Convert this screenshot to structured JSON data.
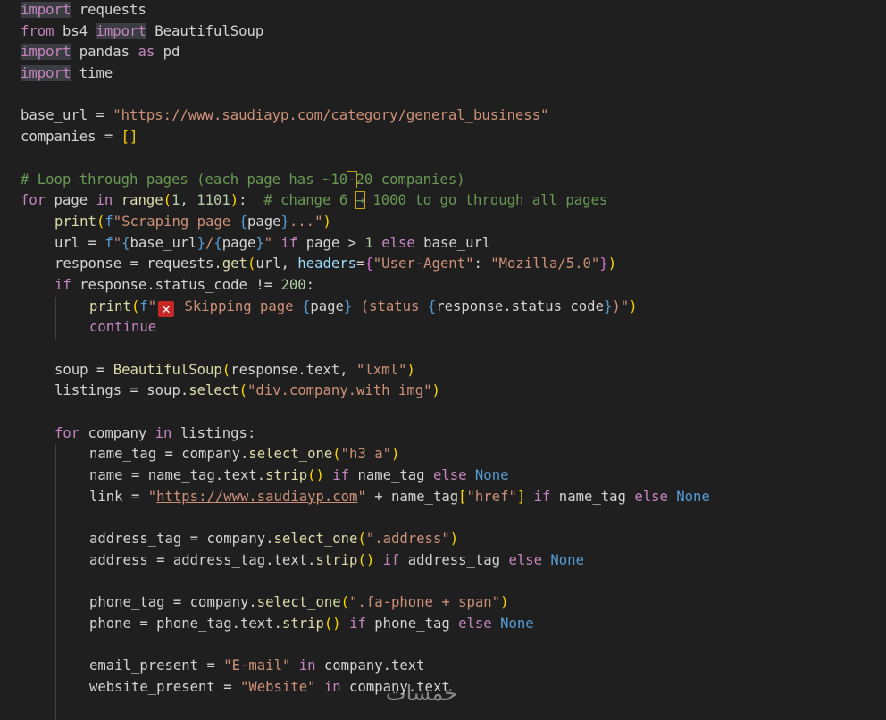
{
  "lines": [
    {
      "id": "l1",
      "indent": 0,
      "tokens": [
        [
          "import",
          "kw-purple hl-import"
        ],
        [
          " requests",
          "plain"
        ]
      ]
    },
    {
      "id": "l2",
      "indent": 0,
      "tokens": [
        [
          "from",
          "kw-purple"
        ],
        [
          " bs4 ",
          "plain"
        ],
        [
          "import",
          "kw-purple hl-import"
        ],
        [
          " BeautifulSoup",
          "plain"
        ]
      ]
    },
    {
      "id": "l3",
      "indent": 0,
      "tokens": [
        [
          "import",
          "kw-purple hl-import"
        ],
        [
          " pandas ",
          "plain"
        ],
        [
          "as",
          "kw-purple"
        ],
        [
          " pd",
          "plain"
        ]
      ]
    },
    {
      "id": "l4",
      "indent": 0,
      "tokens": [
        [
          "import",
          "kw-purple hl-import"
        ],
        [
          " time",
          "plain"
        ]
      ]
    },
    {
      "id": "l5",
      "indent": 0,
      "tokens": []
    },
    {
      "id": "l6",
      "indent": 0,
      "tokens": [
        [
          "base_url",
          "plain"
        ],
        [
          " = ",
          "plain"
        ],
        [
          "\"",
          "str"
        ],
        [
          "https://www.saudiayp.com/category/general_business",
          "str-link"
        ],
        [
          "\"",
          "str"
        ]
      ]
    },
    {
      "id": "l7",
      "indent": 0,
      "tokens": [
        [
          "companies",
          "plain"
        ],
        [
          " = ",
          "plain"
        ],
        [
          "[]",
          "paren1"
        ]
      ]
    },
    {
      "id": "l8",
      "indent": 0,
      "tokens": []
    },
    {
      "id": "l9",
      "indent": 0,
      "tokens": [
        [
          "# Loop through pages (each page has ~10",
          "comment"
        ],
        [
          "-",
          "comment warnbox"
        ],
        [
          "20 companies)",
          "comment"
        ]
      ]
    },
    {
      "id": "l10",
      "indent": 0,
      "tokens": [
        [
          "for",
          "kw-purple"
        ],
        [
          " page ",
          "plain"
        ],
        [
          "in",
          "kw-purple"
        ],
        [
          " ",
          "plain"
        ],
        [
          "range",
          "fn"
        ],
        [
          "(",
          "paren1"
        ],
        [
          "1",
          "num"
        ],
        [
          ", ",
          "plain"
        ],
        [
          "1101",
          "num"
        ],
        [
          ")",
          "paren1"
        ],
        [
          ":  ",
          "plain"
        ],
        [
          "# change 6 ",
          "comment"
        ],
        [
          "→",
          "comment warnbox"
        ],
        [
          " 1000 to go through all pages",
          "comment"
        ]
      ]
    },
    {
      "id": "l11",
      "indent": 1,
      "tokens": [
        [
          "print",
          "fn"
        ],
        [
          "(",
          "paren1"
        ],
        [
          "f",
          "kw-blue"
        ],
        [
          "\"Scraping page ",
          "str"
        ],
        [
          "{",
          "kw-blue"
        ],
        [
          "page",
          "plain"
        ],
        [
          "}",
          "kw-blue"
        ],
        [
          "...\"",
          "str"
        ],
        [
          ")",
          "paren1"
        ]
      ]
    },
    {
      "id": "l12",
      "indent": 1,
      "tokens": [
        [
          "url",
          "plain"
        ],
        [
          " = ",
          "plain"
        ],
        [
          "f",
          "kw-blue"
        ],
        [
          "\"",
          "str"
        ],
        [
          "{",
          "kw-blue"
        ],
        [
          "base_url",
          "plain"
        ],
        [
          "}",
          "kw-blue"
        ],
        [
          "/",
          "str"
        ],
        [
          "{",
          "kw-blue"
        ],
        [
          "page",
          "plain"
        ],
        [
          "}",
          "kw-blue"
        ],
        [
          "\"",
          "str"
        ],
        [
          " ",
          "plain"
        ],
        [
          "if",
          "kw-purple"
        ],
        [
          " page > ",
          "plain"
        ],
        [
          "1",
          "num"
        ],
        [
          " ",
          "plain"
        ],
        [
          "else",
          "kw-purple"
        ],
        [
          " base_url",
          "plain"
        ]
      ]
    },
    {
      "id": "l13",
      "indent": 1,
      "tokens": [
        [
          "response",
          "plain"
        ],
        [
          " = requests.",
          "plain"
        ],
        [
          "get",
          "fn"
        ],
        [
          "(",
          "paren1"
        ],
        [
          "url, ",
          "plain"
        ],
        [
          "headers",
          "var"
        ],
        [
          "=",
          "plain"
        ],
        [
          "{",
          "paren2"
        ],
        [
          "\"User-Agent\"",
          "str"
        ],
        [
          ": ",
          "plain"
        ],
        [
          "\"Mozilla/5.0\"",
          "str"
        ],
        [
          "}",
          "paren2"
        ],
        [
          ")",
          "paren1"
        ]
      ]
    },
    {
      "id": "l14",
      "indent": 1,
      "tokens": [
        [
          "if",
          "kw-purple"
        ],
        [
          " response.status_code != ",
          "plain"
        ],
        [
          "200",
          "num"
        ],
        [
          ":",
          "plain"
        ]
      ]
    },
    {
      "id": "l15",
      "indent": 2,
      "tokens": [
        [
          "print",
          "fn"
        ],
        [
          "(",
          "paren1"
        ],
        [
          "f",
          "kw-blue"
        ],
        [
          "\"",
          "str"
        ],
        [
          "✕",
          "x-emoji"
        ],
        [
          " Skipping page ",
          "str"
        ],
        [
          "{",
          "kw-blue"
        ],
        [
          "page",
          "plain"
        ],
        [
          "}",
          "kw-blue"
        ],
        [
          " (status ",
          "str"
        ],
        [
          "{",
          "kw-blue"
        ],
        [
          "response.status_code",
          "plain"
        ],
        [
          "}",
          "kw-blue"
        ],
        [
          ")\"",
          "str"
        ],
        [
          ")",
          "paren1"
        ]
      ]
    },
    {
      "id": "l16",
      "indent": 2,
      "tokens": [
        [
          "continue",
          "kw-purple"
        ]
      ]
    },
    {
      "id": "l17",
      "indent": 1,
      "tokens": []
    },
    {
      "id": "l18",
      "indent": 1,
      "tokens": [
        [
          "soup",
          "plain"
        ],
        [
          " = ",
          "plain"
        ],
        [
          "BeautifulSoup",
          "fn"
        ],
        [
          "(",
          "paren1"
        ],
        [
          "response.text, ",
          "plain"
        ],
        [
          "\"lxml\"",
          "str"
        ],
        [
          ")",
          "paren1"
        ]
      ]
    },
    {
      "id": "l19",
      "indent": 1,
      "tokens": [
        [
          "listings",
          "plain"
        ],
        [
          " = soup.",
          "plain"
        ],
        [
          "select",
          "fn"
        ],
        [
          "(",
          "paren1"
        ],
        [
          "\"div.company.with_img\"",
          "str"
        ],
        [
          ")",
          "paren1"
        ]
      ]
    },
    {
      "id": "l20",
      "indent": 1,
      "tokens": []
    },
    {
      "id": "l21",
      "indent": 1,
      "tokens": [
        [
          "for",
          "kw-purple"
        ],
        [
          " company ",
          "plain"
        ],
        [
          "in",
          "kw-purple"
        ],
        [
          " listings:",
          "plain"
        ]
      ]
    },
    {
      "id": "l22",
      "indent": 2,
      "tokens": [
        [
          "name_tag",
          "plain"
        ],
        [
          " = company.",
          "plain"
        ],
        [
          "select_one",
          "fn"
        ],
        [
          "(",
          "paren1"
        ],
        [
          "\"h3 a\"",
          "str"
        ],
        [
          ")",
          "paren1"
        ]
      ]
    },
    {
      "id": "l23",
      "indent": 2,
      "tokens": [
        [
          "name",
          "plain"
        ],
        [
          " = name_tag.text.",
          "plain"
        ],
        [
          "strip",
          "fn"
        ],
        [
          "()",
          "paren1"
        ],
        [
          " ",
          "plain"
        ],
        [
          "if",
          "kw-purple"
        ],
        [
          " name_tag ",
          "plain"
        ],
        [
          "else",
          "kw-purple"
        ],
        [
          " ",
          "plain"
        ],
        [
          "None",
          "kw-blue"
        ]
      ]
    },
    {
      "id": "l24",
      "indent": 2,
      "tokens": [
        [
          "link",
          "plain"
        ],
        [
          " = ",
          "plain"
        ],
        [
          "\"",
          "str"
        ],
        [
          "https://www.saudiayp.com",
          "str-link"
        ],
        [
          "\"",
          "str"
        ],
        [
          " + name_tag",
          "plain"
        ],
        [
          "[",
          "paren1"
        ],
        [
          "\"href\"",
          "str"
        ],
        [
          "]",
          "paren1"
        ],
        [
          " ",
          "plain"
        ],
        [
          "if",
          "kw-purple"
        ],
        [
          " name_tag ",
          "plain"
        ],
        [
          "else",
          "kw-purple"
        ],
        [
          " ",
          "plain"
        ],
        [
          "None",
          "kw-blue"
        ]
      ]
    },
    {
      "id": "l25",
      "indent": 2,
      "tokens": []
    },
    {
      "id": "l26",
      "indent": 2,
      "tokens": [
        [
          "address_tag",
          "plain"
        ],
        [
          " = company.",
          "plain"
        ],
        [
          "select_one",
          "fn"
        ],
        [
          "(",
          "paren1"
        ],
        [
          "\".address\"",
          "str"
        ],
        [
          ")",
          "paren1"
        ]
      ]
    },
    {
      "id": "l27",
      "indent": 2,
      "tokens": [
        [
          "address",
          "plain"
        ],
        [
          " = address_tag.text.",
          "plain"
        ],
        [
          "strip",
          "fn"
        ],
        [
          "()",
          "paren1"
        ],
        [
          " ",
          "plain"
        ],
        [
          "if",
          "kw-purple"
        ],
        [
          " address_tag ",
          "plain"
        ],
        [
          "else",
          "kw-purple"
        ],
        [
          " ",
          "plain"
        ],
        [
          "None",
          "kw-blue"
        ]
      ]
    },
    {
      "id": "l28",
      "indent": 2,
      "tokens": []
    },
    {
      "id": "l29",
      "indent": 2,
      "tokens": [
        [
          "phone_tag",
          "plain"
        ],
        [
          " = company.",
          "plain"
        ],
        [
          "select_one",
          "fn"
        ],
        [
          "(",
          "paren1"
        ],
        [
          "\".fa-phone + span\"",
          "str"
        ],
        [
          ")",
          "paren1"
        ]
      ]
    },
    {
      "id": "l30",
      "indent": 2,
      "tokens": [
        [
          "phone",
          "plain"
        ],
        [
          " = phone_tag.text.",
          "plain"
        ],
        [
          "strip",
          "fn"
        ],
        [
          "()",
          "paren1"
        ],
        [
          " ",
          "plain"
        ],
        [
          "if",
          "kw-purple"
        ],
        [
          " phone_tag ",
          "plain"
        ],
        [
          "else",
          "kw-purple"
        ],
        [
          " ",
          "plain"
        ],
        [
          "None",
          "kw-blue"
        ]
      ]
    },
    {
      "id": "l31",
      "indent": 2,
      "tokens": []
    },
    {
      "id": "l32",
      "indent": 2,
      "tokens": [
        [
          "email_present",
          "plain"
        ],
        [
          " = ",
          "plain"
        ],
        [
          "\"E-mail\"",
          "str"
        ],
        [
          " ",
          "plain"
        ],
        [
          "in",
          "kw-purple"
        ],
        [
          " company.text",
          "plain"
        ]
      ]
    },
    {
      "id": "l33",
      "indent": 2,
      "tokens": [
        [
          "website_present",
          "plain"
        ],
        [
          " = ",
          "plain"
        ],
        [
          "\"Website\"",
          "str"
        ],
        [
          " ",
          "plain"
        ],
        [
          "in",
          "kw-purple"
        ],
        [
          " company.text",
          "plain"
        ]
      ]
    }
  ],
  "watermark": "خمسات",
  "colors": {
    "background": "#1f1f1f",
    "keyword": "#c586c0",
    "function": "#dcdcaa",
    "string": "#ce9178",
    "number": "#b5cea8",
    "comment": "#6a9955",
    "constant": "#569cd6"
  },
  "icons": {
    "skip_marker": "cross-mark-icon"
  }
}
